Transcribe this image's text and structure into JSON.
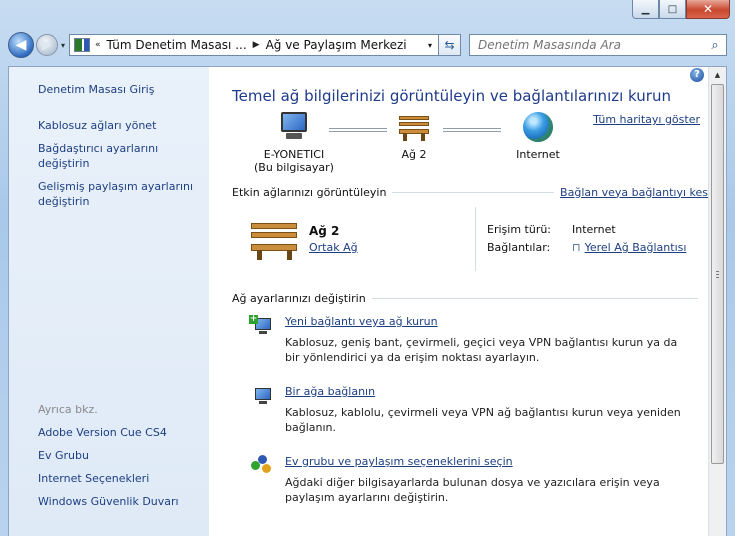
{
  "window": {
    "min_glyph": "▁",
    "max_glyph": "□",
    "close_glyph": "✕"
  },
  "nav": {
    "back_glyph": "◀",
    "forward_glyph": "▶",
    "dropdown_glyph": "▾",
    "breadcrumb_prefix": "«",
    "breadcrumb": [
      "Tüm Denetim Masası ...",
      "Ağ ve Paylaşım Merkezi"
    ],
    "breadcrumb_sep": "▶",
    "refresh_glyph": "⇆",
    "search_placeholder": "Denetim Masasında Ara"
  },
  "sidebar": {
    "home": "Denetim Masası Giriş",
    "tasks": [
      "Kablosuz ağları yönet",
      "Bağdaştırıcı ayarlarını değiştirin",
      "Gelişmiş paylaşım ayarlarını değiştirin"
    ],
    "see_also_header": "Ayrıca bkz.",
    "see_also": [
      "Adobe Version Cue CS4",
      "Ev Grubu",
      "Internet Seçenekleri",
      "Windows Güvenlik Duvarı"
    ]
  },
  "main": {
    "help_glyph": "?",
    "title": "Temel ağ bilgilerinizi görüntüleyin ve bağlantılarınızı kurun",
    "full_map": "Tüm haritayı göster",
    "map": {
      "computer_name": "E-YONETICI",
      "computer_sub": "(Bu bilgisayar)",
      "network": "Ağ  2",
      "internet": "Internet"
    },
    "active_section": {
      "label": "Etkin ağlarınızı görüntüleyin",
      "action": "Bağlan veya bağlantıyı kes"
    },
    "network": {
      "name": "Ağ  2",
      "type": "Ortak Ağ",
      "access_label": "Erişim türü:",
      "access_value": "Internet",
      "connections_label": "Bağlantılar:",
      "connections_value": "Yerel Ağ Bağlantısı"
    },
    "settings_section": {
      "label": "Ağ ayarlarınızı değiştirin"
    },
    "tasks": [
      {
        "title": "Yeni bağlantı veya ağ kurun",
        "desc": "Kablosuz, geniş bant, çevirmeli, geçici veya VPN bağlantısı kurun ya da bir yönlendirici ya da erişim noktası ayarlayın."
      },
      {
        "title": "Bir ağa bağlanın",
        "desc": "Kablosuz, kablolu, çevirmeli veya VPN ağ bağlantısı kurun veya yeniden bağlanın."
      },
      {
        "title": "Ev grubu ve paylaşım seçeneklerini seçin",
        "desc": "Ağdaki diğer bilgisayarlarda bulunan dosya ve yazıcılara erişin veya paylaşım ayarlarını değiştirin."
      }
    ]
  },
  "colors": {
    "link": "#1d3f82",
    "title": "#1e3a8a",
    "sidebar_bg": "#e9f1fa"
  },
  "icons": {
    "back": "back-arrow-icon",
    "forward": "forward-arrow-icon",
    "search": "magnifier-icon",
    "help": "help-icon",
    "computer": "computer-icon",
    "bench": "public-network-bench-icon",
    "globe": "internet-globe-icon"
  }
}
